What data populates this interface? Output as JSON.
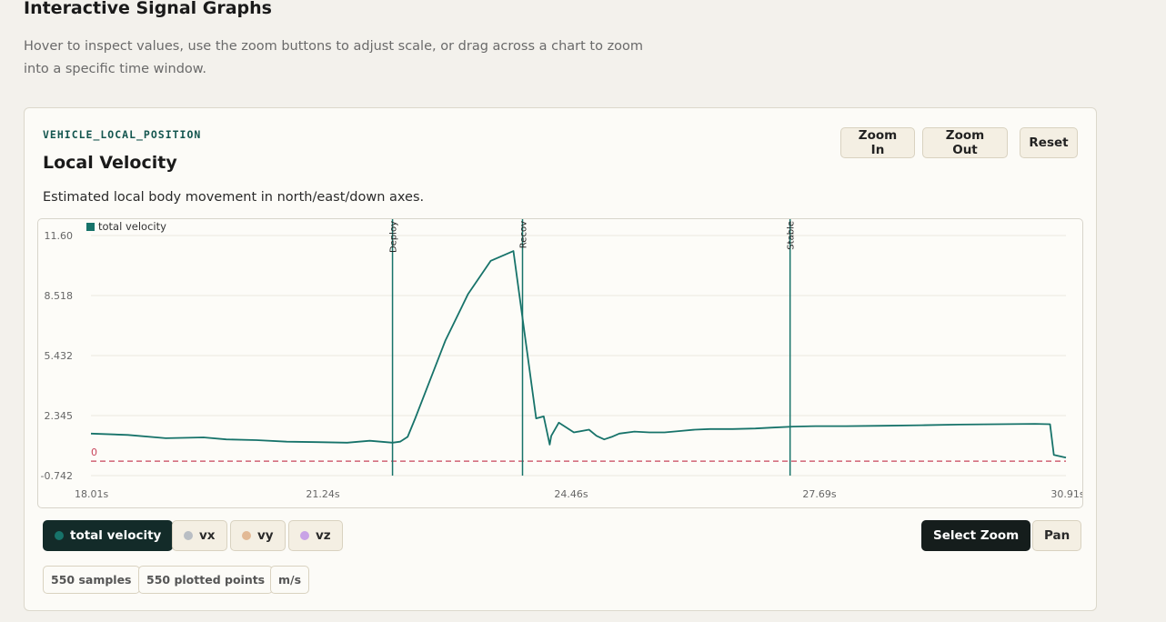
{
  "page": {
    "title": "Interactive Signal Graphs",
    "description": "Hover to inspect values, use the zoom buttons to adjust scale, or drag across a chart to zoom into a specific time window."
  },
  "card": {
    "topic": "VEHICLE_LOCAL_POSITION",
    "title": "Local Velocity",
    "description": "Estimated local body movement in north/east/down axes.",
    "zoom_in_label": "Zoom In",
    "zoom_out_label": "Zoom Out",
    "reset_label": "Reset"
  },
  "chart_data": {
    "type": "line",
    "legend": [
      "total velocity"
    ],
    "series": [
      {
        "name": "total velocity",
        "color": "#17736a",
        "x": [
          18.01,
          18.5,
          19.0,
          19.5,
          19.8,
          20.2,
          20.6,
          21.0,
          21.4,
          21.7,
          22.0,
          22.1,
          22.2,
          22.3,
          22.5,
          22.7,
          23.0,
          23.3,
          23.6,
          23.9,
          24.0,
          24.08,
          24.1,
          24.2,
          24.4,
          24.6,
          24.7,
          24.8,
          24.9,
          25.0,
          25.2,
          25.4,
          25.6,
          25.8,
          26.0,
          26.2,
          26.5,
          26.8,
          27.0,
          27.3,
          27.6,
          28.0,
          28.5,
          29.0,
          29.5,
          30.0,
          30.5,
          30.7,
          30.75,
          30.91
        ],
        "y": [
          1.42,
          1.35,
          1.18,
          1.22,
          1.12,
          1.08,
          1.0,
          0.98,
          0.95,
          1.05,
          0.95,
          1.0,
          1.25,
          2.2,
          4.2,
          6.2,
          8.6,
          10.3,
          10.8,
          2.2,
          2.3,
          0.85,
          1.3,
          1.98,
          1.48,
          1.62,
          1.3,
          1.12,
          1.25,
          1.42,
          1.52,
          1.48,
          1.48,
          1.55,
          1.62,
          1.65,
          1.65,
          1.68,
          1.72,
          1.78,
          1.8,
          1.8,
          1.82,
          1.85,
          1.88,
          1.9,
          1.92,
          1.9,
          0.32,
          0.18
        ]
      }
    ],
    "reference_line": {
      "value": 0,
      "label": "0",
      "color": "#c8455b"
    },
    "markers": [
      {
        "x": 22.0,
        "label": "Deploy"
      },
      {
        "x": 23.72,
        "label": "Recov"
      },
      {
        "x": 27.26,
        "label": "Stable"
      }
    ],
    "x_ticks": [
      "18.01s",
      "21.24s",
      "24.46s",
      "27.69s",
      "30.91s"
    ],
    "y_ticks": [
      "11.60",
      "8.518",
      "5.432",
      "2.345",
      "-0.742"
    ],
    "xlim": [
      18.01,
      30.91
    ],
    "ylim": [
      -0.742,
      11.6
    ],
    "grid": true,
    "legend_position": "top-left"
  },
  "series_toggles": [
    {
      "label": "total velocity",
      "color": "#17736a",
      "active": true
    },
    {
      "label": "vx",
      "color": "#b9bec4",
      "active": false
    },
    {
      "label": "vy",
      "color": "#e2b995",
      "active": false
    },
    {
      "label": "vz",
      "color": "#c9a3e6",
      "active": false
    }
  ],
  "modes": {
    "select_zoom": "Select Zoom",
    "pan": "Pan"
  },
  "stats": {
    "samples": "550 samples",
    "plotted": "550 plotted points",
    "unit": "m/s"
  }
}
